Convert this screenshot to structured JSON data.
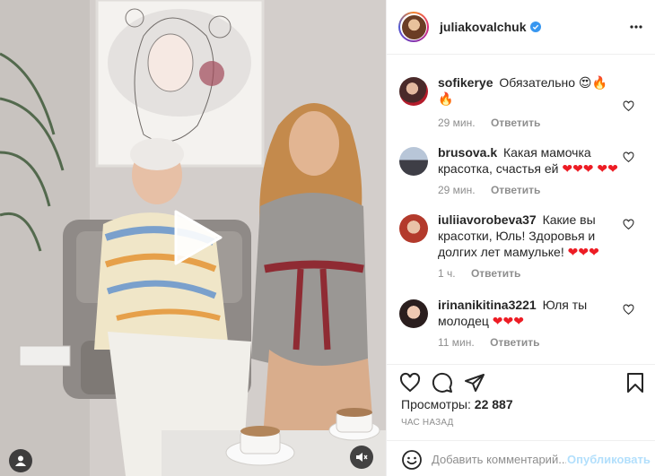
{
  "post": {
    "username": "juliakovalchuk",
    "verified": true,
    "more_icon": "more-options-icon"
  },
  "comments": [
    {
      "user": "sofikerye",
      "text": "Обязательно",
      "emoji": "😍🔥🔥",
      "time": "29 мин.",
      "reply": "Ответить"
    },
    {
      "user": "brusova.k",
      "text": "Какая мамочка красотка, счастья ей",
      "emoji": "❤❤❤ ❤❤",
      "time": "29 мин.",
      "reply": "Ответить"
    },
    {
      "user": "iuliiavorobeva37",
      "text": "Какие вы красотки, Юль! Здоровья и долгих лет мамульке!",
      "emoji": "❤❤❤",
      "time": "1 ч.",
      "reply": "Ответить"
    },
    {
      "user": "irinanikitina3221",
      "text": "Юля ты молодец",
      "emoji": "❤❤❤",
      "time": "11 мин.",
      "reply": "Ответить"
    }
  ],
  "stats": {
    "views_label": "Просмотры:",
    "views_count": "22 887",
    "time_ago": "ЧАС НАЗАД"
  },
  "composer": {
    "placeholder": "Добавить комментарий...",
    "post_label": "Опубликовать"
  },
  "colors": {
    "accent": "#0095f6",
    "post_disabled": "#b2dffc",
    "heart": "#ed1c24"
  }
}
